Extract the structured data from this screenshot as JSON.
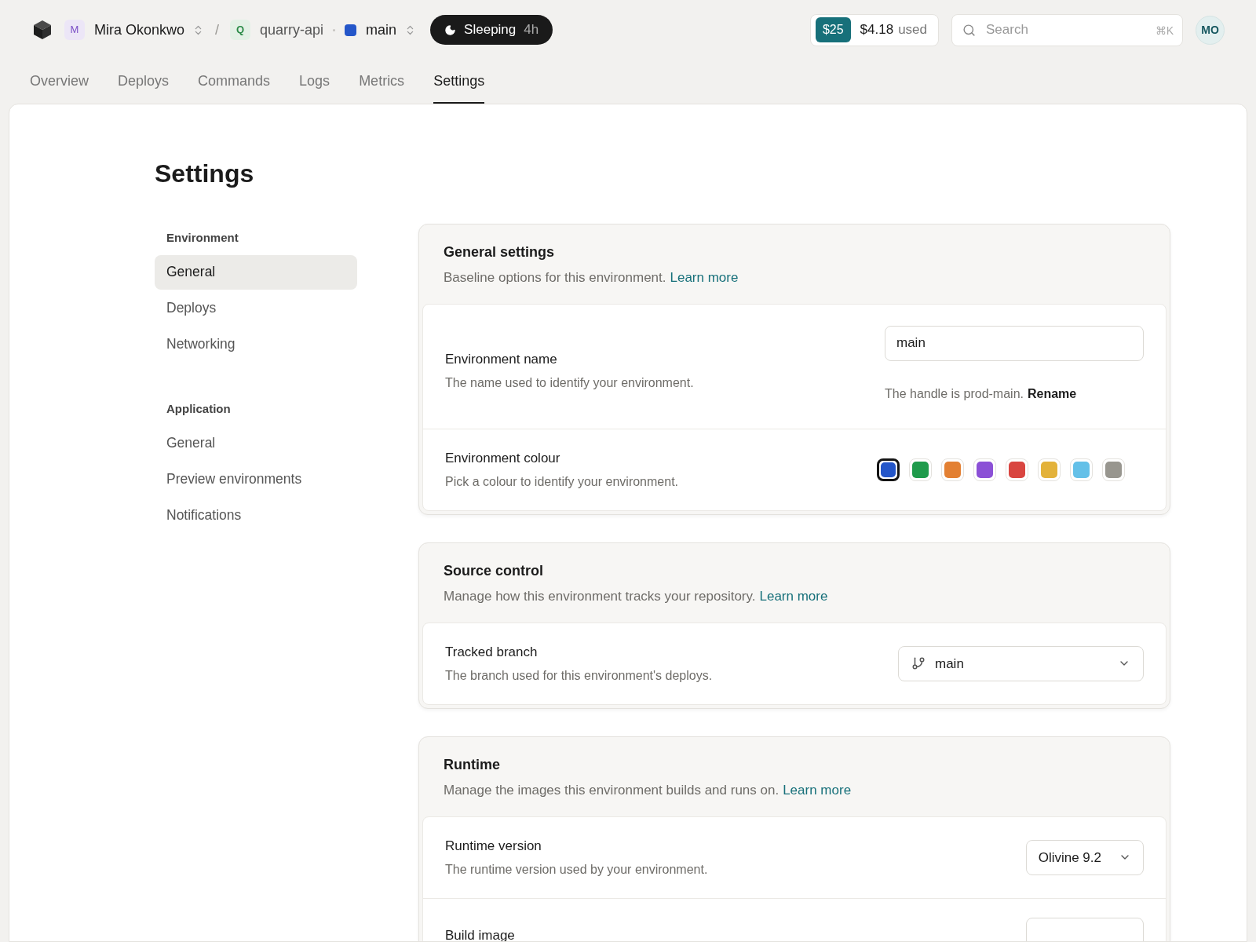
{
  "header": {
    "org": {
      "initial": "M",
      "name": "Mira Okonkwo"
    },
    "separator": "/",
    "project": {
      "initial": "Q",
      "name": "quarry-api"
    },
    "environment": {
      "name": "main",
      "color": "#2456c9"
    },
    "status": {
      "label": "Sleeping",
      "duration": "4h"
    },
    "credit": {
      "amount": "$25",
      "used": "$4.18",
      "used_label": "used"
    },
    "search": {
      "placeholder": "Search",
      "shortcut": "⌘K"
    },
    "avatar": "MO"
  },
  "tabs": [
    {
      "label": "Overview",
      "selected": false
    },
    {
      "label": "Deploys",
      "selected": false
    },
    {
      "label": "Commands",
      "selected": false
    },
    {
      "label": "Logs",
      "selected": false
    },
    {
      "label": "Metrics",
      "selected": false
    },
    {
      "label": "Settings",
      "selected": true
    }
  ],
  "page_title": "Settings",
  "sidebar": {
    "sections": [
      {
        "heading": "Environment",
        "items": [
          {
            "label": "General",
            "selected": true
          },
          {
            "label": "Deploys",
            "selected": false
          },
          {
            "label": "Networking",
            "selected": false
          }
        ]
      },
      {
        "heading": "Application",
        "items": [
          {
            "label": "General",
            "selected": false
          },
          {
            "label": "Preview environments",
            "selected": false
          },
          {
            "label": "Notifications",
            "selected": false
          }
        ]
      }
    ]
  },
  "sections": [
    {
      "title": "General settings",
      "description": "Baseline options for this environment.",
      "link": "Learn more",
      "rows": [
        {
          "kind": "text",
          "label": "Environment name",
          "description": "The name used to identify your environment.",
          "value": "main",
          "hint": "The handle is prod-main.",
          "hint_action": "Rename"
        },
        {
          "kind": "colors",
          "label": "Environment colour",
          "description": "Pick a colour to identify your environment.",
          "swatches": [
            {
              "color": "#2456c9",
              "selected": true
            },
            {
              "color": "#1f9b4c",
              "selected": false
            },
            {
              "color": "#e38033",
              "selected": false
            },
            {
              "color": "#8b50d6",
              "selected": false
            },
            {
              "color": "#d94540",
              "selected": false
            },
            {
              "color": "#e3b23a",
              "selected": false
            },
            {
              "color": "#64c0e8",
              "selected": false
            },
            {
              "color": "#98968f",
              "selected": false
            }
          ]
        }
      ]
    },
    {
      "title": "Source control",
      "description": "Manage how this environment tracks your repository.",
      "link": "Learn more",
      "rows": [
        {
          "kind": "branch",
          "label": "Tracked branch",
          "description": "The branch used for this environment's deploys.",
          "value": "main"
        }
      ]
    },
    {
      "title": "Runtime",
      "description": "Manage the images this environment builds and runs on.",
      "link": "Learn more",
      "rows": [
        {
          "kind": "select",
          "label": "Runtime version",
          "description": "The runtime version used by your environment.",
          "value": "Olivine 9.2"
        },
        {
          "kind": "select",
          "label": "Build image"
        }
      ]
    }
  ]
}
